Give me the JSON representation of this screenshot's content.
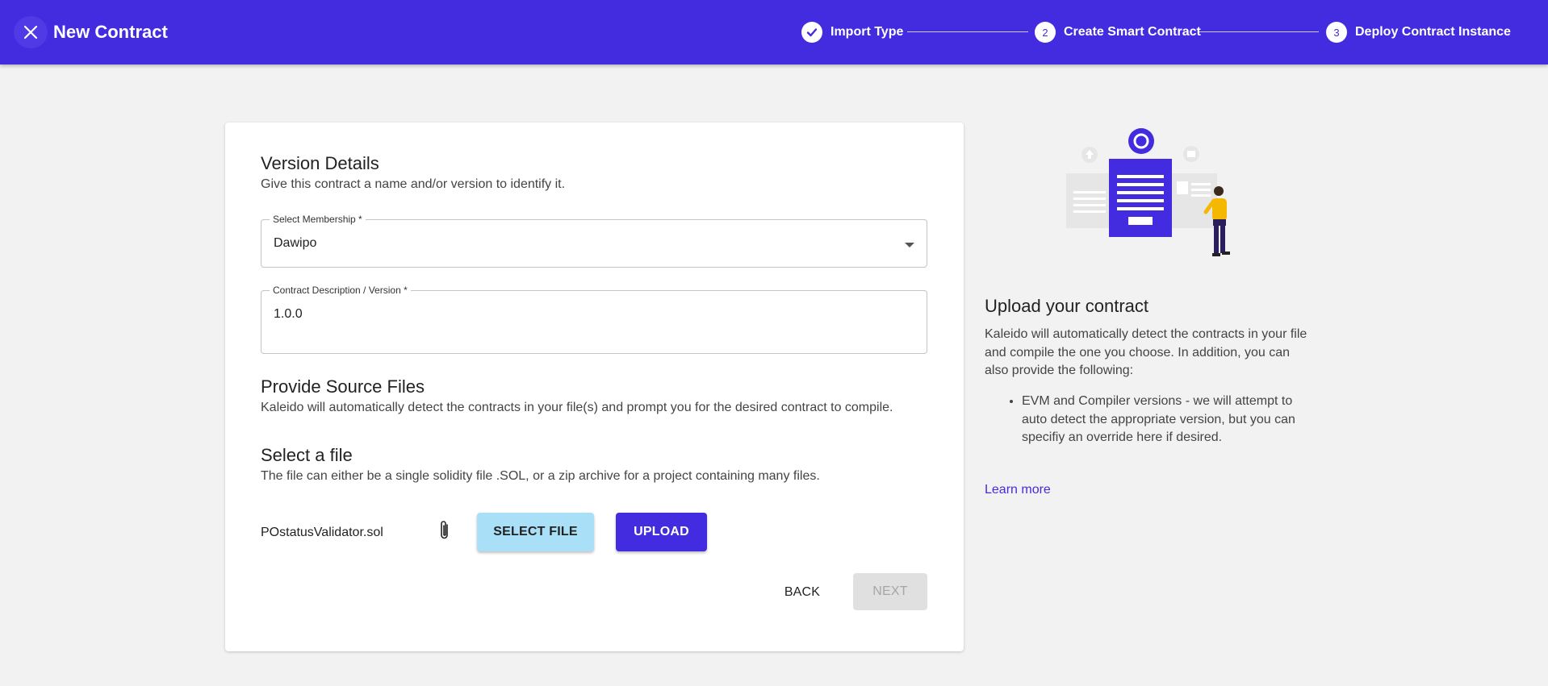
{
  "header": {
    "title": "New Contract",
    "steps": [
      {
        "label": "Import Type",
        "state": "done",
        "marker": ""
      },
      {
        "label": "Create Smart Contract",
        "state": "active",
        "marker": "2"
      },
      {
        "label": "Deploy Contract Instance",
        "state": "pending",
        "marker": "3"
      }
    ]
  },
  "form": {
    "version_details": {
      "title": "Version Details",
      "subtitle": "Give this contract a name and/or version to identify it."
    },
    "membership": {
      "label": "Select Membership *",
      "value": "Dawipo"
    },
    "version": {
      "label": "Contract Description / Version *",
      "value": "1.0.0"
    },
    "source_files": {
      "title": "Provide Source Files",
      "subtitle": "Kaleido will automatically detect the contracts in your file(s) and prompt you for the desired contract to compile."
    },
    "select_file": {
      "title": "Select a file",
      "subtitle": "The file can either be a single solidity file .SOL, or a zip archive for a project containing many files.",
      "file_name": "POstatusValidator.sol",
      "select_label": "SELECT FILE",
      "upload_label": "UPLOAD"
    },
    "back_label": "BACK",
    "next_label": "NEXT"
  },
  "side": {
    "title": "Upload your contract",
    "text": "Kaleido will automatically detect the contracts in your file and compile the one you choose. In addition, you can also provide the following:",
    "bullets": [
      "EVM and Compiler versions - we will attempt to auto detect the appropriate version, but you can specifiy an override here if desired."
    ],
    "learn_more": "Learn more"
  },
  "colors": {
    "primary": "#432be0",
    "accent_light": "#a9e0f8",
    "background": "#f2f2f2"
  }
}
